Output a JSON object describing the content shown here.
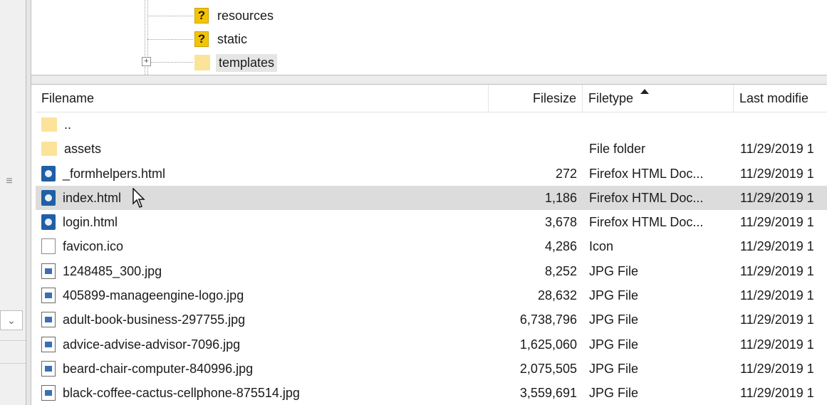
{
  "tree": {
    "items": [
      {
        "label": "resources",
        "icon": "question-folder-icon"
      },
      {
        "label": "static",
        "icon": "question-folder-icon"
      },
      {
        "label": "templates",
        "icon": "folder-icon",
        "expander": "+"
      }
    ]
  },
  "list": {
    "columns": {
      "filename": "Filename",
      "filesize": "Filesize",
      "filetype": "Filetype",
      "last_modified": "Last modifie"
    },
    "rows": [
      {
        "name": "..",
        "size": "",
        "type": "",
        "date": "",
        "icon": "folder-icon"
      },
      {
        "name": "assets",
        "size": "",
        "type": "File folder",
        "date": "11/29/2019 1",
        "icon": "folder-icon"
      },
      {
        "name": "_formhelpers.html",
        "size": "272",
        "type": "Firefox HTML Doc...",
        "date": "11/29/2019 1",
        "icon": "html-file-icon"
      },
      {
        "name": "index.html",
        "size": "1,186",
        "type": "Firefox HTML Doc...",
        "date": "11/29/2019 1",
        "icon": "html-file-icon"
      },
      {
        "name": "login.html",
        "size": "3,678",
        "type": "Firefox HTML Doc...",
        "date": "11/29/2019 1",
        "icon": "html-file-icon"
      },
      {
        "name": "favicon.ico",
        "size": "4,286",
        "type": "Icon",
        "date": "11/29/2019 1",
        "icon": "blank-file-icon"
      },
      {
        "name": "1248485_300.jpg",
        "size": "8,252",
        "type": "JPG File",
        "date": "11/29/2019 1",
        "icon": "image-file-icon"
      },
      {
        "name": "405899-manageengine-logo.jpg",
        "size": "28,632",
        "type": "JPG File",
        "date": "11/29/2019 1",
        "icon": "image-file-icon"
      },
      {
        "name": "adult-book-business-297755.jpg",
        "size": "6,738,796",
        "type": "JPG File",
        "date": "11/29/2019 1",
        "icon": "image-file-icon"
      },
      {
        "name": "advice-advise-advisor-7096.jpg",
        "size": "1,625,060",
        "type": "JPG File",
        "date": "11/29/2019 1",
        "icon": "image-file-icon"
      },
      {
        "name": "beard-chair-computer-840996.jpg",
        "size": "2,075,505",
        "type": "JPG File",
        "date": "11/29/2019 1",
        "icon": "image-file-icon"
      },
      {
        "name": "black-coffee-cactus-cellphone-875514.jpg",
        "size": "3,559,691",
        "type": "JPG File",
        "date": "11/29/2019 1",
        "icon": "image-file-icon"
      }
    ],
    "selected_row": "index.html"
  },
  "left_strip": {
    "handle_glyph": "≡",
    "scroll_glyph": "⌄"
  }
}
